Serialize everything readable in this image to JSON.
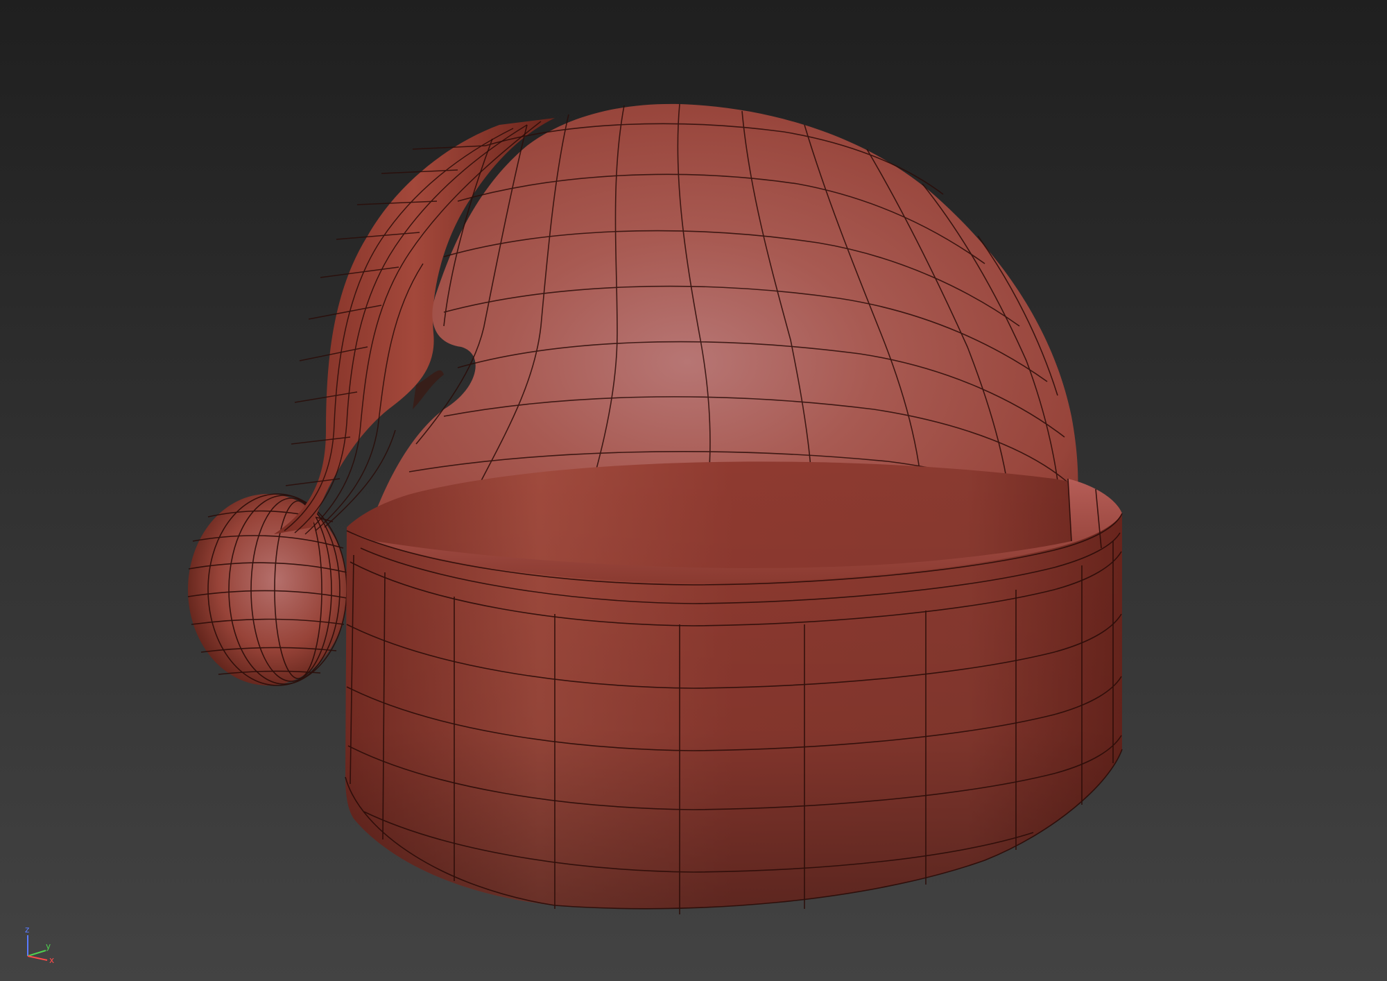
{
  "viewport": {
    "background_top": "#1f1f1f",
    "background_bottom": "#434343"
  },
  "model": {
    "name": "santa-hat",
    "base_color": "#a8463a",
    "wire_color": "#2a0c08"
  },
  "axis_gizmo": {
    "z_label": "z",
    "y_label": "y",
    "x_label": "x",
    "z_color": "#5a7bff",
    "y_color": "#4fd14f",
    "x_color": "#ff4a4a"
  }
}
